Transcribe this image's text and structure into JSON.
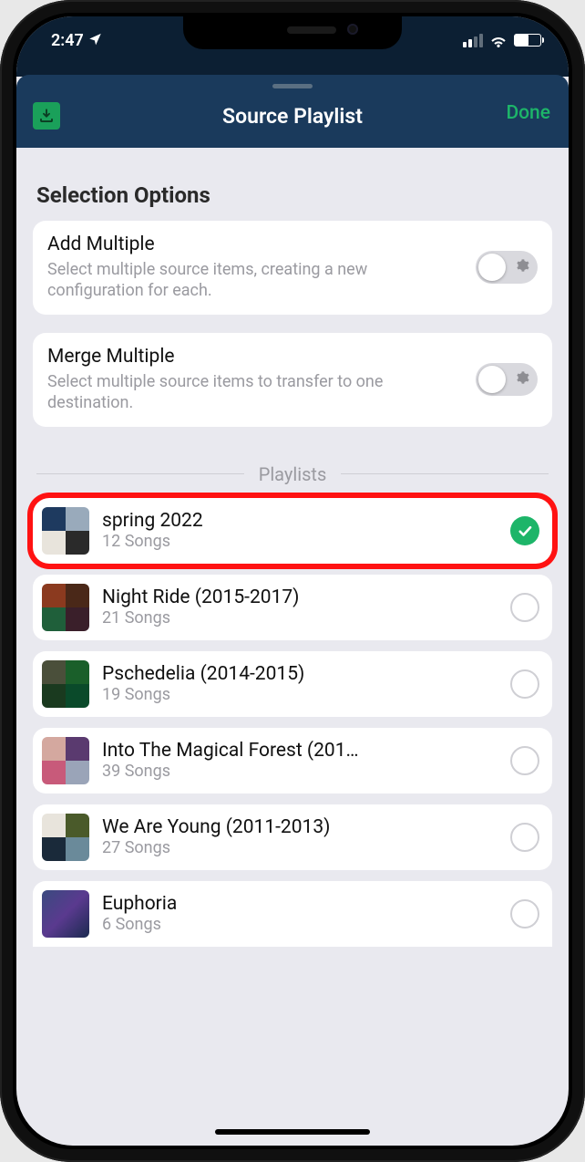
{
  "status": {
    "time": "2:47",
    "battery_pct": 52
  },
  "nav": {
    "title": "Source Playlist",
    "done_label": "Done"
  },
  "selection": {
    "heading": "Selection Options",
    "options": [
      {
        "title": "Add Multiple",
        "description": "Select multiple source items, creating a new configuration for each.",
        "enabled": false
      },
      {
        "title": "Merge Multiple",
        "description": "Select multiple source items to transfer to one destination.",
        "enabled": false
      }
    ]
  },
  "playlists_heading": "Playlists",
  "playlists": [
    {
      "name": "spring 2022",
      "subtitle": "12 Songs",
      "selected": true,
      "highlighted": true
    },
    {
      "name": "Night Ride (2015-2017)",
      "subtitle": "21 Songs",
      "selected": false
    },
    {
      "name": "Pschedelia (2014-2015)",
      "subtitle": "19 Songs",
      "selected": false
    },
    {
      "name": "Into The Magical Forest (201…",
      "subtitle": "39 Songs",
      "selected": false
    },
    {
      "name": "We Are Young (2011-2013)",
      "subtitle": "27 Songs",
      "selected": false
    },
    {
      "name": "Euphoria",
      "subtitle": "6 Songs",
      "selected": false
    }
  ]
}
